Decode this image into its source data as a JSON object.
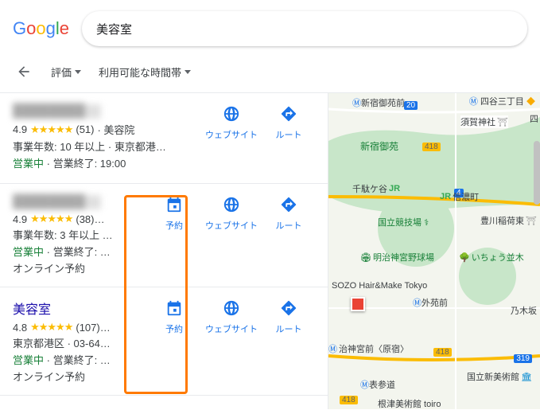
{
  "logo": "Google",
  "search": {
    "value": "美容室"
  },
  "filters": {
    "rating": "評価",
    "hours": "利用可能な時間帯"
  },
  "actions": {
    "website": "ウェブサイト",
    "directions": "ルート",
    "booking": "予約"
  },
  "entries": [
    {
      "title": "████████",
      "title_visible": false,
      "rating": "4.9",
      "stars": "★★★★★",
      "reviews": "(51)",
      "category": "美容院",
      "meta1": "事業年数: 10 年以上 · 東京都港…",
      "open": "営業中",
      "closes": "営業終了: 19:00",
      "online": "",
      "has_booking": false
    },
    {
      "title": "████████",
      "title_visible": false,
      "rating": "4.9",
      "stars": "★★★★★",
      "reviews": "(38)…",
      "category": "",
      "meta1": "事業年数: 3 年以上 …",
      "open": "営業中",
      "closes": "営業終了: …",
      "online": "オンライン予約",
      "has_booking": true
    },
    {
      "title": "美容室",
      "title_visible": true,
      "rating": "4.8",
      "stars": "★★★★★",
      "reviews": "(107)…",
      "category": "",
      "meta1": "東京都港区 · 03-64…",
      "open": "営業中",
      "closes": "営業終了: …",
      "online": "オンライン予約",
      "has_booking": true
    }
  ],
  "map_labels": {
    "shinjuku_gyoen_mae": "新宿御苑前",
    "yotsuya_sanchome": "四谷三丁目",
    "suga_shrine": "須賀神社",
    "shinjuku_gyoen": "新宿御苑",
    "sendagaya": "千駄ケ谷",
    "shinanomachi": "信濃町",
    "stadium": "国立競技場",
    "toyokawa": "豊川稲荷東",
    "meiji_jingu": "明治神宮野球場",
    "ichou": "いちょう並木",
    "sozo": "SOZO Hair&Make Tokyo",
    "gaien_mae": "外苑前",
    "nogizaka": "乃木坂",
    "meiji_jingu_mae": "治神宮前〈原宿〉",
    "omotesando": "表参道",
    "museum": "国立新美術館",
    "nezu": "根津美術館 toiro",
    "route_20": "20",
    "route_418": "418",
    "route_319": "319",
    "route_418b": "418",
    "route_418c": "418",
    "route_418d": "418",
    "route_4": "4"
  }
}
